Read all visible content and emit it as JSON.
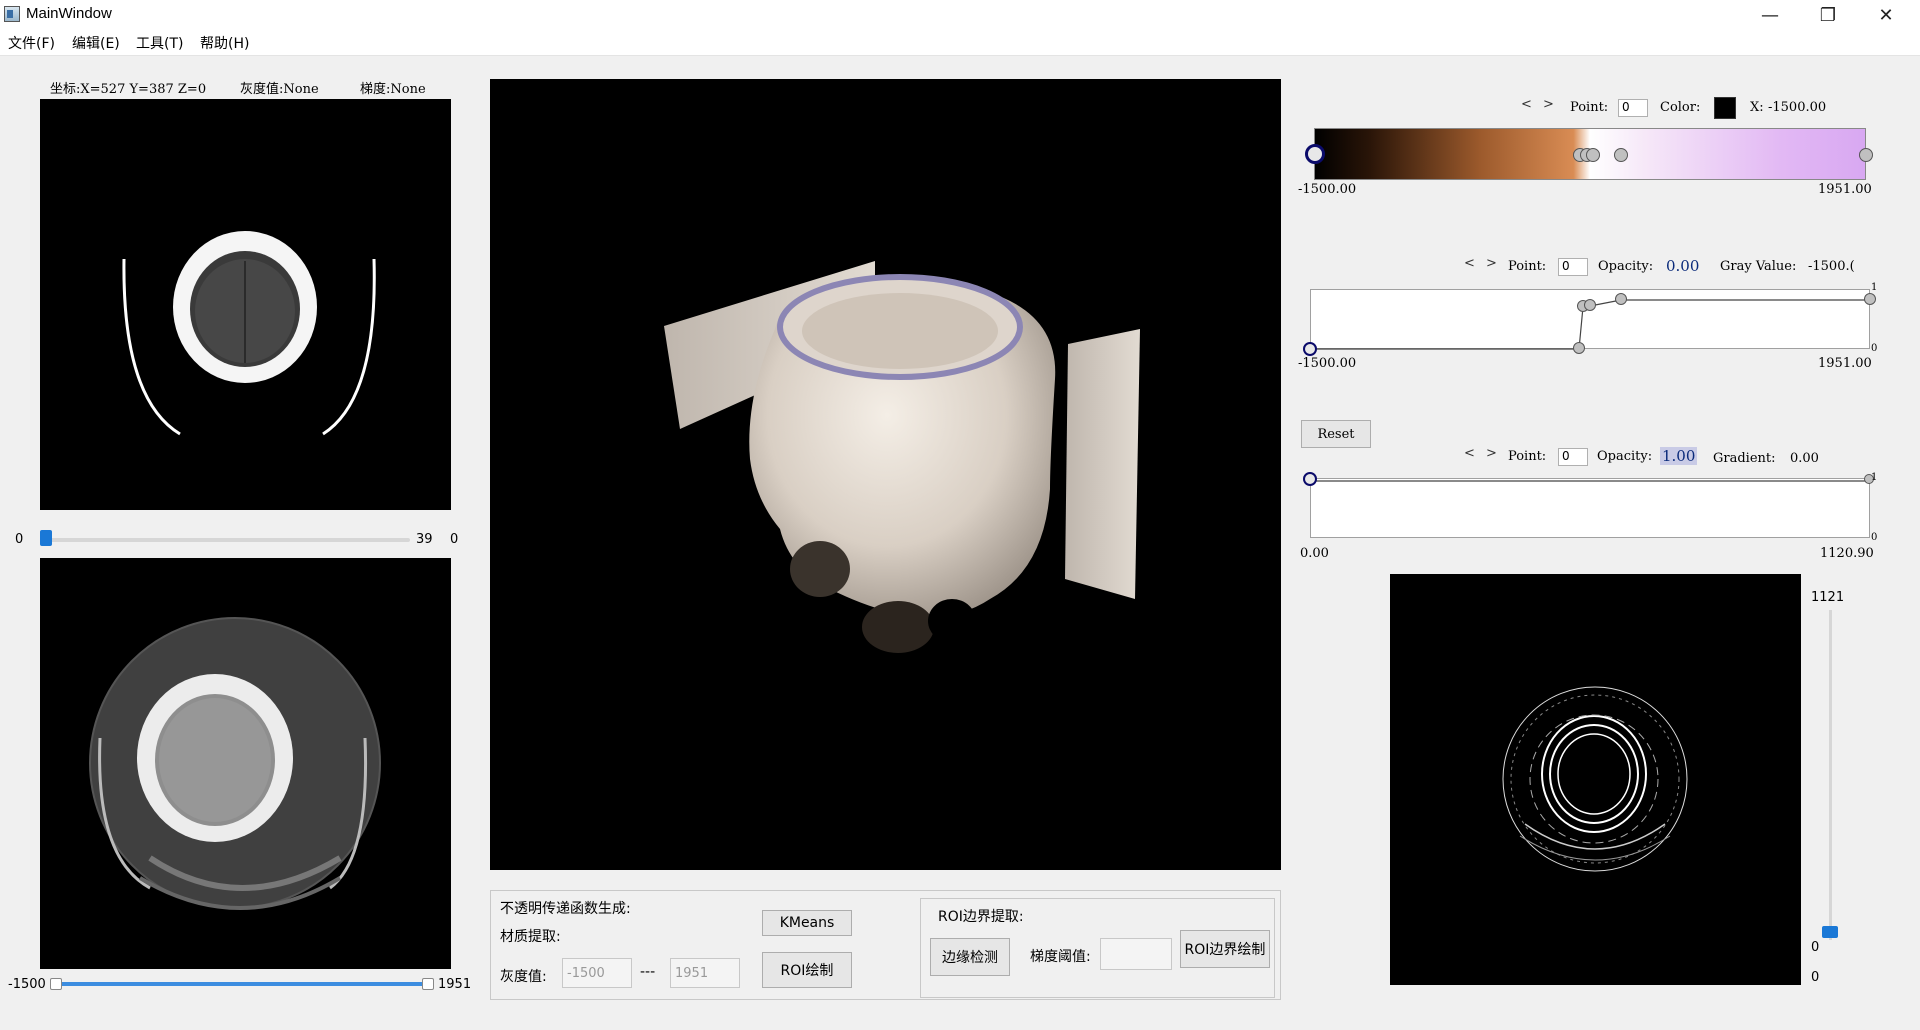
{
  "window": {
    "title": "MainWindow",
    "minimize": "—",
    "maximize": "❐",
    "close": "✕"
  },
  "menu": [
    "文件(F)",
    "编辑(E)",
    "工具(T)",
    "帮助(H)"
  ],
  "left": {
    "status": {
      "coords": "坐标:X=527 Y=387 Z=0",
      "gray": "灰度值:None",
      "gradient": "梯度:None"
    },
    "slice_slider": {
      "min": "0",
      "max": "39",
      "value": "0",
      "level": 0.0
    },
    "range_slider": {
      "min": "-1500",
      "max": "1951",
      "low": 0.0,
      "high": 1.0
    }
  },
  "controls": {
    "opacity_title": "不透明传递函数生成:",
    "material_label": "材质提取:",
    "gray_label": "灰度值:",
    "gray_min_placeholder": "-1500",
    "gray_sep": "---",
    "gray_max_placeholder": "1951",
    "kmeans_button": "KMeans",
    "roi_draw_button": "ROI绘制",
    "roi_boundary_title": "ROI边界提取:",
    "edge_detect_button": "边缘检测",
    "grad_threshold_label": "梯度阈值:",
    "grad_threshold_value": "",
    "roi_boundary_draw_button": "ROI边界绘制"
  },
  "color_tf": {
    "prev": "<",
    "next": ">",
    "point_label": "Point:",
    "point_value": "0",
    "color_label": "Color:",
    "color_swatch": "#000000",
    "x_label": "X:",
    "x_value": "-1500.00",
    "min_label": "-1500.00",
    "max_label": "1951.00",
    "gradient_stops": [
      "#000000",
      "#2a1508",
      "#9c5a2c",
      "#d98c54",
      "#ffffff",
      "#f6e8f8",
      "#e2b8f4",
      "#d8a8f2"
    ]
  },
  "opacity_tf": {
    "prev": "<",
    "next": ">",
    "point_label": "Point:",
    "point_value": "0",
    "opacity_label": "Opacity:",
    "opacity_value": "0.00",
    "gray_label": "Gray Value:",
    "gray_value": "-1500.(",
    "min_label": "-1500.00",
    "max_label": "1951.00",
    "y_top": "1",
    "y_bottom": "0"
  },
  "gradient_tf": {
    "reset_button": "Reset",
    "prev": "<",
    "next": ">",
    "point_label": "Point:",
    "point_value": "0",
    "opacity_label": "Opacity:",
    "opacity_value": "1.00",
    "gradient_label": "Gradient:",
    "gradient_value": "0.00",
    "min_label": "0.00",
    "max_label": "1120.90",
    "y_top": "1",
    "y_bottom": "0"
  },
  "edge_view": {
    "slider_max": "1121",
    "slider_value": "0",
    "slider_min": "0",
    "level": 0.0
  },
  "colors": {
    "accent": "#1a78d6",
    "selected_node": "#0b0b6a"
  }
}
